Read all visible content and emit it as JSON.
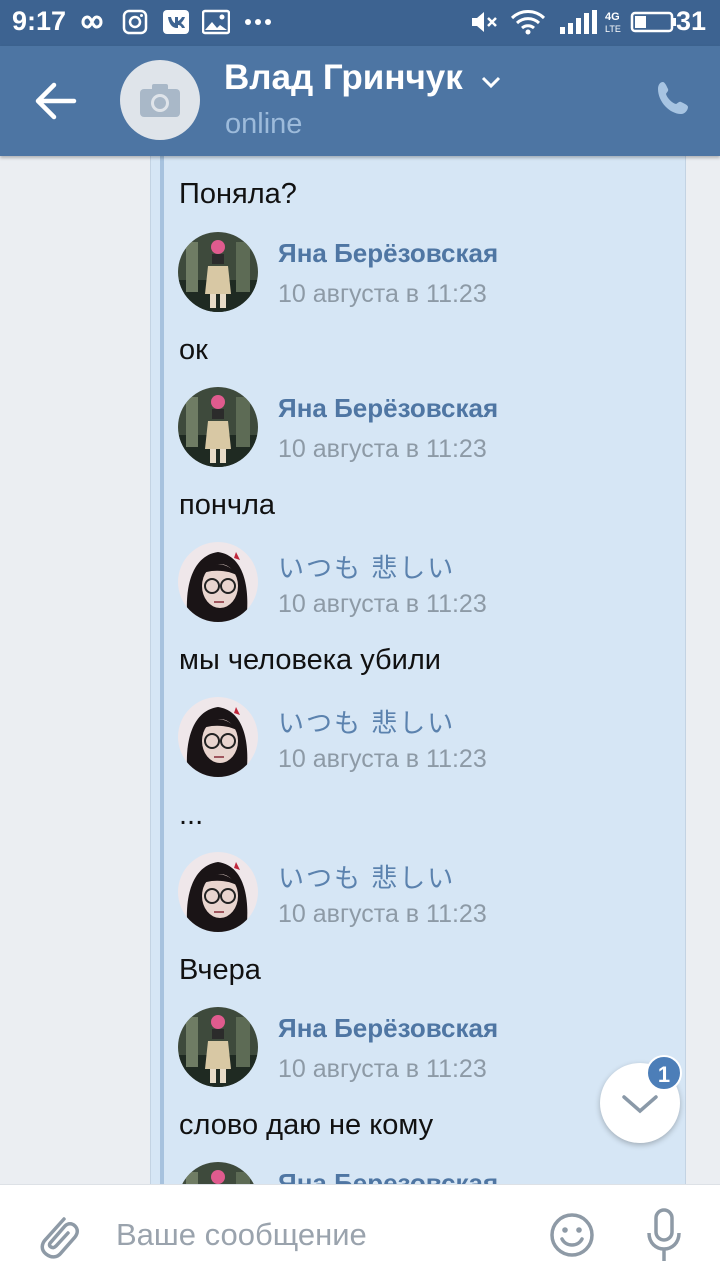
{
  "status_bar": {
    "time": "9:17",
    "battery_level": "31"
  },
  "header": {
    "title": "Влад Гринчук",
    "subtitle": "online"
  },
  "messages": [
    {
      "text": "Поняла?"
    },
    {
      "author": "Яна Берёзовская",
      "date": "10 августа в 11:23",
      "text": "ок"
    },
    {
      "author": "Яна Берёзовская",
      "date": "10 августа в 11:23",
      "text": "пончла"
    },
    {
      "author": "いつも 悲しい",
      "date": "10 августа в 11:23",
      "text": "мы человека убили"
    },
    {
      "author": "いつも 悲しい",
      "date": "10 августа в 11:23",
      "text": "..."
    },
    {
      "author": "いつも 悲しい",
      "date": "10 августа в 11:23",
      "text": "Вчера"
    },
    {
      "author": "Яна Берёзовская",
      "date": "10 августа в 11:23",
      "text": "слово даю не кому"
    },
    {
      "author": "Яна Березовская"
    }
  ],
  "scroll_fab": {
    "badge": "1"
  },
  "composer": {
    "placeholder": "Ваше сообщение"
  },
  "colors": {
    "header": "#4d75a3",
    "status_bar": "#3d6391",
    "forward_box": "#d6e6f5",
    "name_link": "#4f76a3"
  }
}
